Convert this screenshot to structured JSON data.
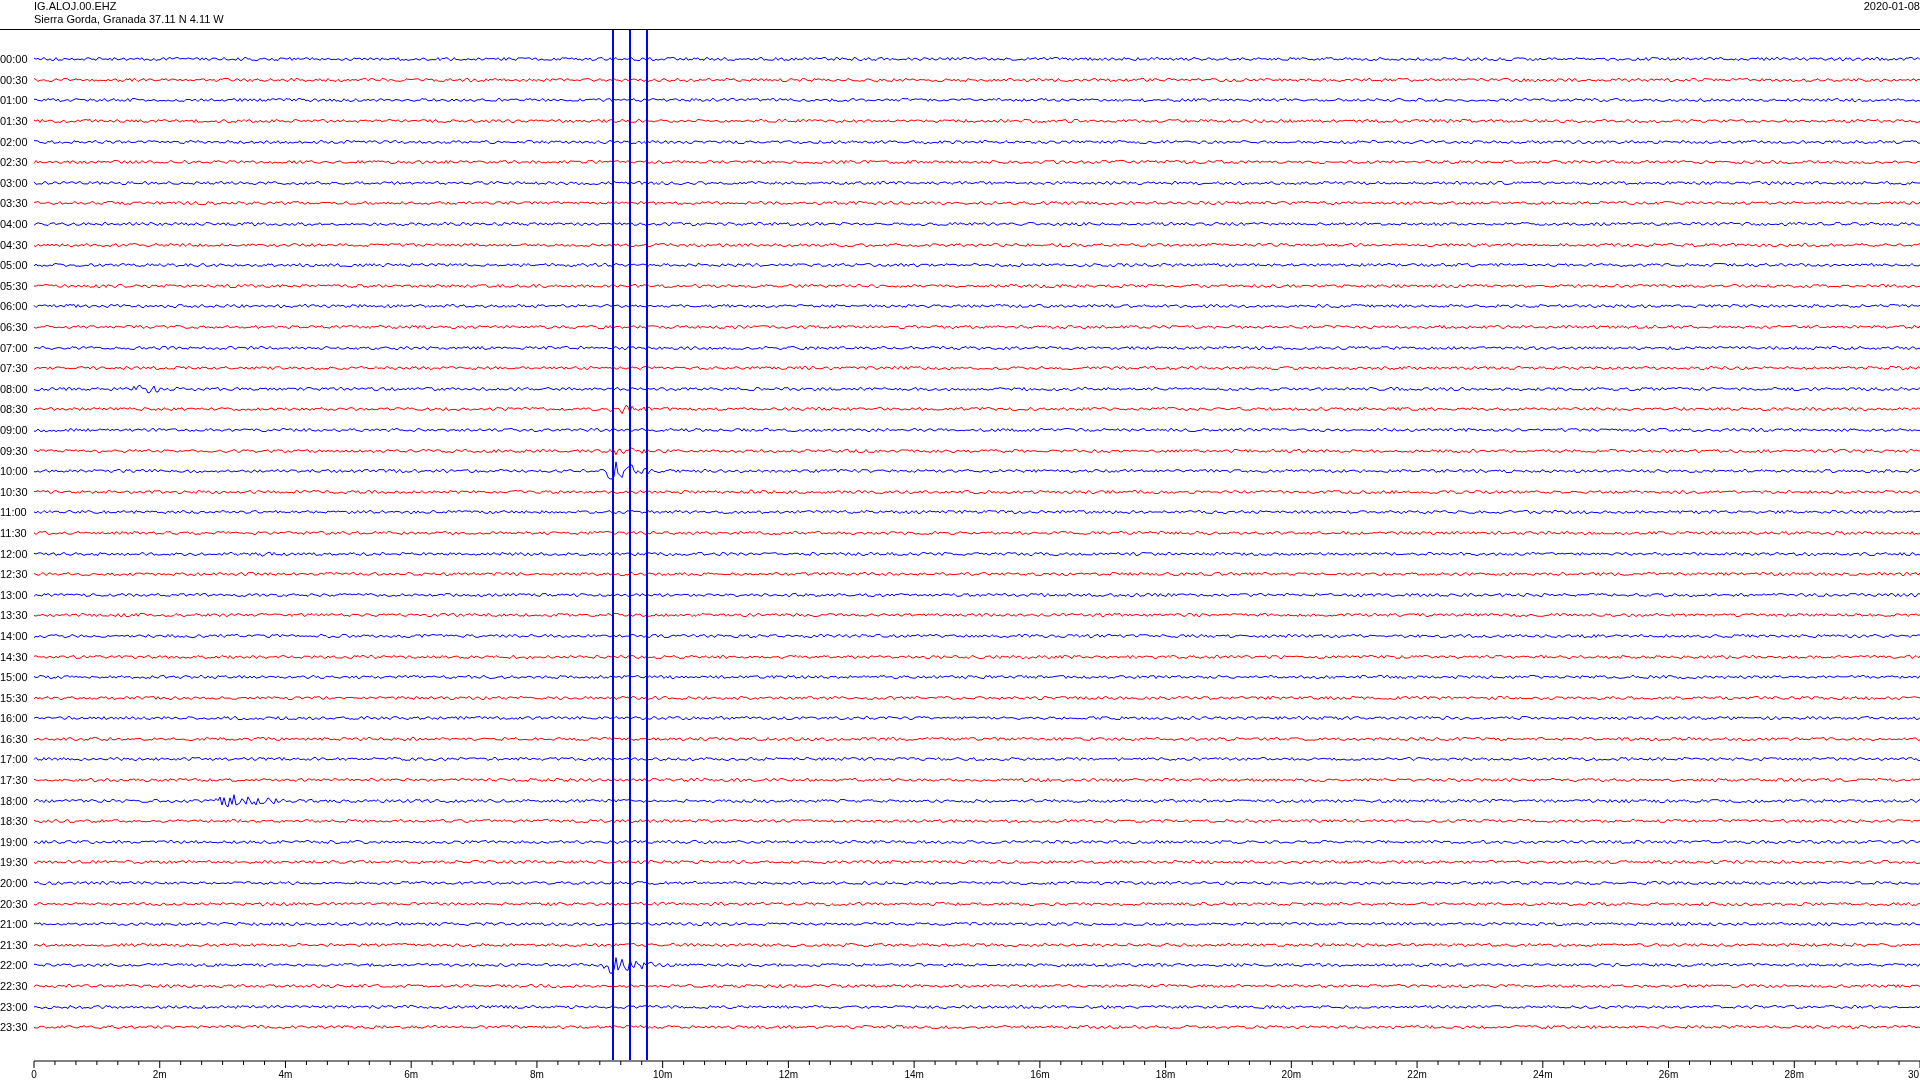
{
  "header": {
    "station": "IG.ALOJ.00.EHZ",
    "location": "Sierra Gorda, Granada  37.11 N 4.11 W",
    "date": "2020-01-08"
  },
  "rows": [
    {
      "time": "00:00",
      "color": "#0000ff"
    },
    {
      "time": "00:30",
      "color": "#ff0000"
    },
    {
      "time": "01:00",
      "color": "#0000ff"
    },
    {
      "time": "01:30",
      "color": "#ff0000"
    },
    {
      "time": "02:00",
      "color": "#0000ff"
    },
    {
      "time": "02:30",
      "color": "#ff0000"
    },
    {
      "time": "03:00",
      "color": "#0000ff"
    },
    {
      "time": "03:30",
      "color": "#ff0000"
    },
    {
      "time": "04:00",
      "color": "#0000ff"
    },
    {
      "time": "04:30",
      "color": "#ff0000"
    },
    {
      "time": "05:00",
      "color": "#0000ff"
    },
    {
      "time": "05:30",
      "color": "#ff0000"
    },
    {
      "time": "06:00",
      "color": "#0000ff"
    },
    {
      "time": "06:30",
      "color": "#ff0000"
    },
    {
      "time": "07:00",
      "color": "#0000ff"
    },
    {
      "time": "07:30",
      "color": "#ff0000"
    },
    {
      "time": "08:00",
      "color": "#0000ff"
    },
    {
      "time": "08:30",
      "color": "#ff0000"
    },
    {
      "time": "09:00",
      "color": "#0000ff"
    },
    {
      "time": "09:30",
      "color": "#ff0000"
    },
    {
      "time": "10:00",
      "color": "#0000ff"
    },
    {
      "time": "10:30",
      "color": "#ff0000"
    },
    {
      "time": "11:00",
      "color": "#0000ff"
    },
    {
      "time": "11:30",
      "color": "#ff0000"
    },
    {
      "time": "12:00",
      "color": "#0000ff"
    },
    {
      "time": "12:30",
      "color": "#ff0000"
    },
    {
      "time": "13:00",
      "color": "#0000ff"
    },
    {
      "time": "13:30",
      "color": "#ff0000"
    },
    {
      "time": "14:00",
      "color": "#0000ff"
    },
    {
      "time": "14:30",
      "color": "#ff0000"
    },
    {
      "time": "15:00",
      "color": "#0000ff"
    },
    {
      "time": "15:30",
      "color": "#ff0000"
    },
    {
      "time": "16:00",
      "color": "#0000ff"
    },
    {
      "time": "16:30",
      "color": "#ff0000"
    },
    {
      "time": "17:00",
      "color": "#0000ff"
    },
    {
      "time": "17:30",
      "color": "#ff0000"
    },
    {
      "time": "18:00",
      "color": "#0000ff"
    },
    {
      "time": "18:30",
      "color": "#ff0000"
    },
    {
      "time": "19:00",
      "color": "#0000ff"
    },
    {
      "time": "19:30",
      "color": "#ff0000"
    },
    {
      "time": "20:00",
      "color": "#0000ff"
    },
    {
      "time": "20:30",
      "color": "#ff0000"
    },
    {
      "time": "21:00",
      "color": "#0000ff"
    },
    {
      "time": "21:30",
      "color": "#ff0000"
    },
    {
      "time": "22:00",
      "color": "#0000ff"
    },
    {
      "time": "22:30",
      "color": "#ff0000"
    },
    {
      "time": "23:00",
      "color": "#0000ff"
    },
    {
      "time": "23:30",
      "color": "#ff0000"
    }
  ],
  "x_axis": {
    "labels": [
      "0",
      "2m",
      "4m",
      "6m",
      "8m",
      "10m",
      "12m",
      "14m",
      "16m",
      "18m",
      "20m",
      "22m",
      "24m",
      "26m",
      "28m",
      "30"
    ]
  }
}
